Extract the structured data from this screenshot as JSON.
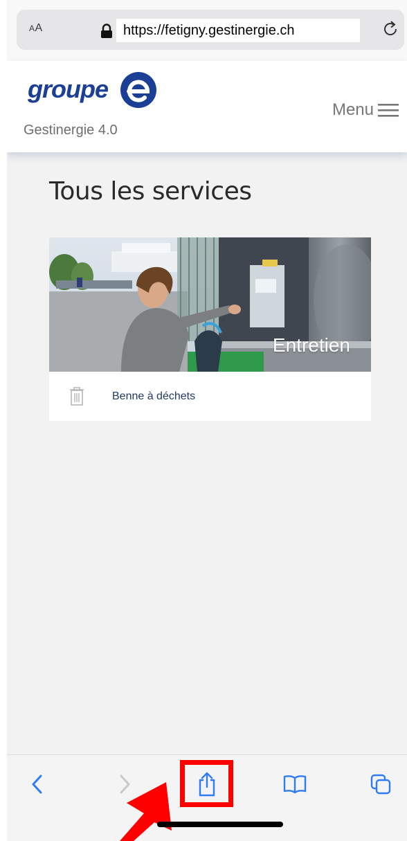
{
  "browser": {
    "text_size_label": "AA",
    "url": "https://fetigny.gestinergie.ch"
  },
  "site": {
    "logo_text": "groupe",
    "logo_mark": "e",
    "subtitle": "Gestinergie 4.0",
    "menu_label": "Menu"
  },
  "page": {
    "title": "Tous les services"
  },
  "services": [
    {
      "category": "Entretien",
      "items": [
        {
          "label": "Benne à déchets",
          "icon": "trash-icon"
        }
      ]
    }
  ],
  "toolbar": {
    "buttons": [
      "back-icon",
      "forward-icon",
      "share-icon",
      "bookmarks-icon",
      "tabs-icon"
    ]
  },
  "colors": {
    "brand_blue": "#1b3f94",
    "highlight_red": "#ff0000",
    "ios_blue": "#2f7bf6"
  }
}
